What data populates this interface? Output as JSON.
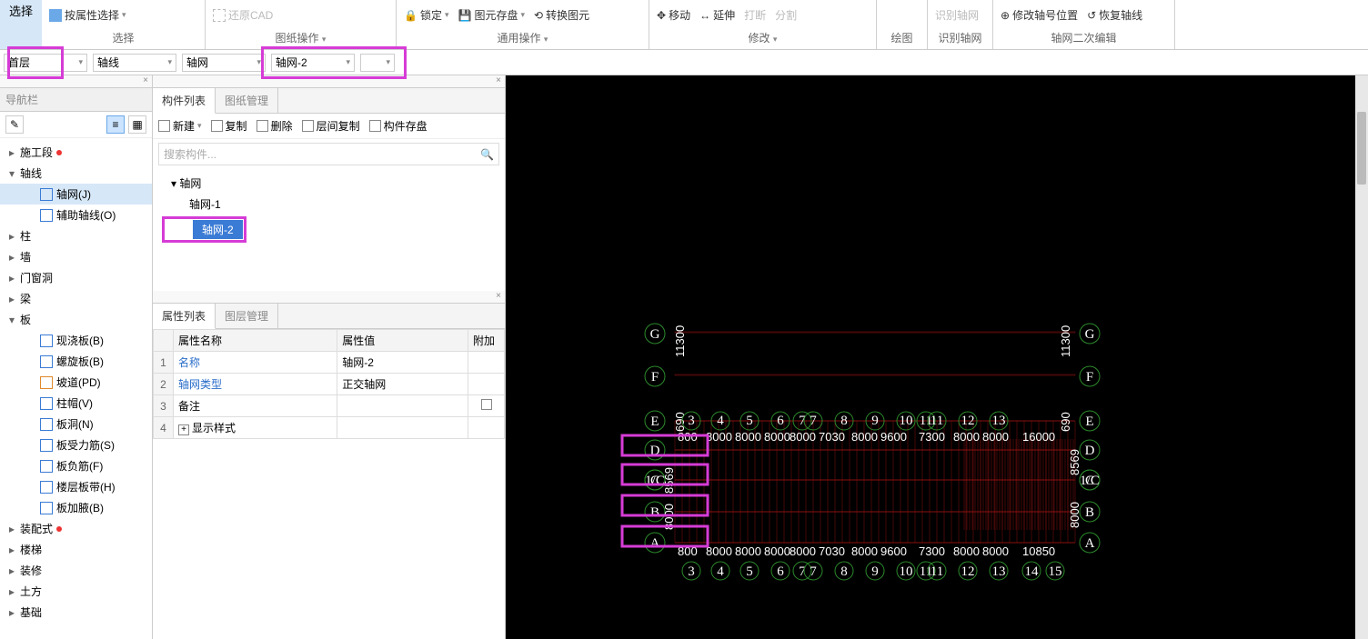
{
  "ribbon": {
    "select_tab": "选择",
    "groups": {
      "select": {
        "attr_select": "按属性选择",
        "label": "选择"
      },
      "drawing": {
        "restore_cad": "还原CAD",
        "label": "图纸操作"
      },
      "common": {
        "lock": "锁定",
        "prim_disk": "图元存盘",
        "convert": "转换图元",
        "label": "通用操作"
      },
      "modify": {
        "move": "移动",
        "extend": "延伸",
        "break": "打断",
        "split": "分割",
        "label": "修改"
      },
      "draw": {
        "label": "绘图"
      },
      "recog": {
        "recog_axis": "识别轴网",
        "label": "识别轴网"
      },
      "edit": {
        "mod_pos": "修改轴号位置",
        "restore_axis": "恢复轴线",
        "label": "轴网二次编辑"
      }
    }
  },
  "selectors": {
    "floor": "首层",
    "cat": "轴线",
    "type": "轴网",
    "item": "轴网-2"
  },
  "nav": {
    "title": "导航栏",
    "items": [
      {
        "label": "施工段",
        "red": true
      },
      {
        "label": "轴线",
        "expanded": true,
        "children": [
          {
            "label": "轴网(J)",
            "sel": true,
            "icon": "blue"
          },
          {
            "label": "辅助轴线(O)",
            "icon": "blue"
          }
        ]
      },
      {
        "label": "柱"
      },
      {
        "label": "墙"
      },
      {
        "label": "门窗洞"
      },
      {
        "label": "梁"
      },
      {
        "label": "板",
        "expanded": true,
        "children": [
          {
            "label": "现浇板(B)",
            "icon": "blue"
          },
          {
            "label": "螺旋板(B)",
            "icon": "blue"
          },
          {
            "label": "坡道(PD)",
            "icon": "orange"
          },
          {
            "label": "柱帽(V)",
            "icon": "blue"
          },
          {
            "label": "板洞(N)",
            "icon": "blue"
          },
          {
            "label": "板受力筋(S)",
            "icon": "blue"
          },
          {
            "label": "板负筋(F)",
            "icon": "blue"
          },
          {
            "label": "楼层板带(H)",
            "icon": "blue"
          },
          {
            "label": "板加腋(B)",
            "icon": "blue"
          }
        ]
      },
      {
        "label": "装配式",
        "red": true
      },
      {
        "label": "楼梯"
      },
      {
        "label": "装修"
      },
      {
        "label": "土方"
      },
      {
        "label": "基础"
      }
    ]
  },
  "midtabs": {
    "list": "构件列表",
    "drawing": "图纸管理"
  },
  "midtools": {
    "new": "新建",
    "copy": "复制",
    "del": "删除",
    "floor_copy": "层间复制",
    "save": "构件存盘"
  },
  "search_ph": "搜索构件...",
  "clist": {
    "root": "轴网",
    "items": [
      "轴网-1",
      "轴网-2"
    ],
    "sel_index": 1
  },
  "proptabs": {
    "list": "属性列表",
    "layer": "图层管理"
  },
  "prop_headers": {
    "name": "属性名称",
    "val": "属性值",
    "add": "附加"
  },
  "props": [
    {
      "n": "1",
      "name": "名称",
      "val": "轴网-2",
      "link": true
    },
    {
      "n": "2",
      "name": "轴网类型",
      "val": "正交轴网",
      "link": true
    },
    {
      "n": "3",
      "name": "备注",
      "val": "",
      "chk": true
    },
    {
      "n": "4",
      "name": "显示样式",
      "val": "",
      "exp": true
    }
  ],
  "canvas": {
    "rows": [
      "G",
      "F",
      "E",
      "D",
      "1/C",
      "C",
      "B",
      "A"
    ],
    "row_y": [
      284,
      331,
      380,
      412,
      445,
      445,
      480,
      514
    ],
    "cols_top": [
      "3",
      "4",
      "5",
      "6",
      "7",
      "7",
      "8",
      "9",
      "10",
      "11",
      "11",
      "12",
      "13"
    ],
    "col_top_x": [
      760,
      792,
      824,
      858,
      882,
      894,
      928,
      962,
      996,
      1018,
      1030,
      1064,
      1098
    ],
    "cols_bot": [
      "3",
      "4",
      "5",
      "6",
      "7",
      "7",
      "8",
      "9",
      "10",
      "11",
      "11",
      "12",
      "13",
      "14",
      "15"
    ],
    "col_bot_x": [
      760,
      792,
      824,
      858,
      882,
      894,
      928,
      962,
      996,
      1018,
      1030,
      1064,
      1098,
      1134,
      1160
    ],
    "dims_top": [
      "800",
      "8000",
      "8000",
      "8000",
      "8000",
      "7030",
      "8000",
      "9600",
      "7300",
      "8000",
      "8000",
      "16000"
    ],
    "dim_top_x": [
      745,
      776,
      808,
      840,
      868,
      900,
      936,
      968,
      1010,
      1048,
      1080,
      1124
    ],
    "dims_bot": [
      "800",
      "8000",
      "8000",
      "8000",
      "8000",
      "7030",
      "8000",
      "9600",
      "7300",
      "8000",
      "8000",
      "10850"
    ],
    "dim_bot_x": [
      745,
      776,
      808,
      840,
      868,
      900,
      936,
      968,
      1010,
      1048,
      1080,
      1124
    ],
    "dims_left_top": "11300",
    "dims_left_mid": "690",
    "dims_left_lo1": "8569",
    "dims_left_lo2": "8000",
    "dims_right_top": "11300",
    "dims_right_lo": "8000",
    "dims_right_mid": "690",
    "dims_right_lo2": "8569"
  }
}
